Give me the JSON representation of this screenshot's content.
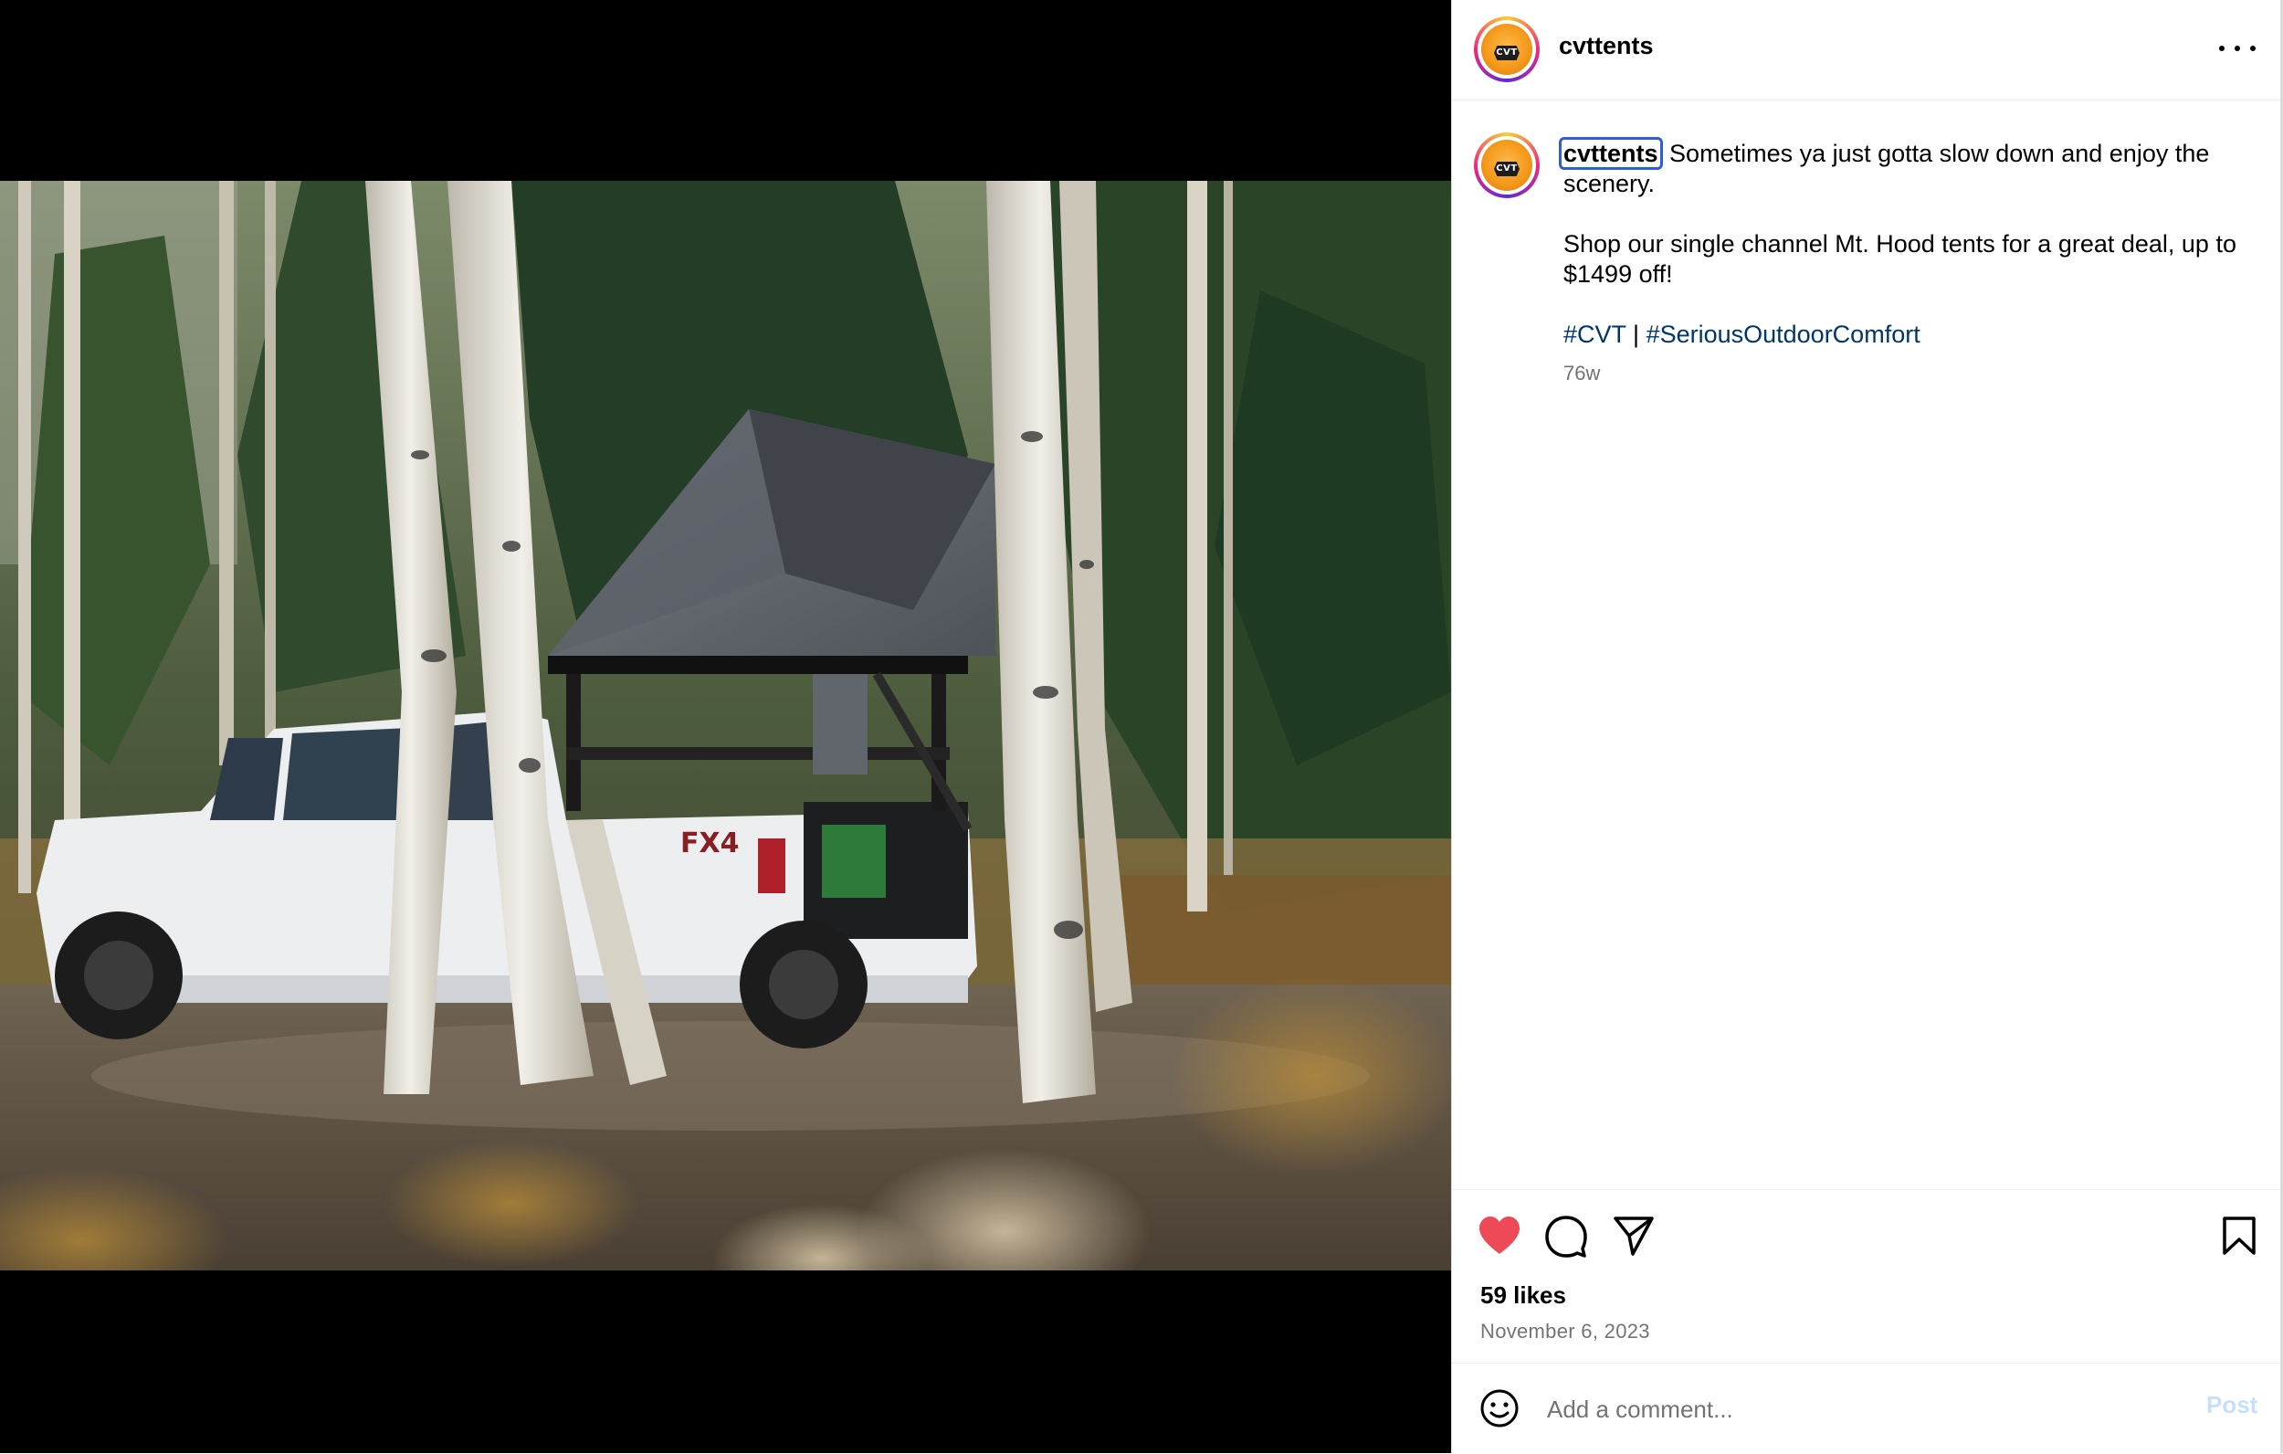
{
  "post": {
    "username": "cvttents",
    "avatar_logo_text": "CVT",
    "caption": {
      "username": "cvttents",
      "line1": "Sometimes ya just gotta slow down and enjoy the scenery.",
      "line2": "Shop our single channel Mt. Hood tents for a great deal, up to $1499 off!",
      "hashtag1": "#CVT",
      "separator": " | ",
      "hashtag2": "#SeriousOutdoorComfort"
    },
    "time_ago": "76w",
    "likes": "59 likes",
    "date": "November 6, 2023"
  },
  "photo": {
    "description_icon": "photo-truck-rooftop-tent",
    "truck_badge_text": "FX4"
  },
  "actions": {
    "like_icon": "heart-filled-icon",
    "comment_icon": "comment-icon",
    "share_icon": "send-icon",
    "save_icon": "bookmark-icon",
    "like_color": "#ed4956"
  },
  "comment": {
    "placeholder": "Add a comment...",
    "post_label": "Post",
    "post_color": "#c5dffe"
  }
}
